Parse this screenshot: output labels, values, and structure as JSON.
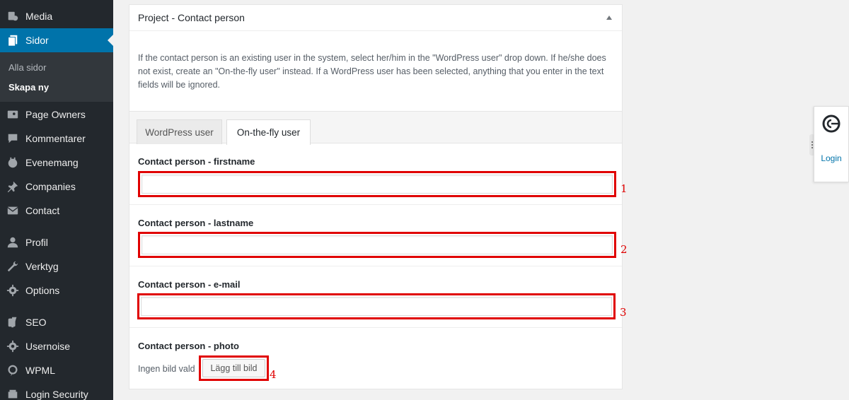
{
  "sidebar": {
    "items": [
      {
        "label": "Media",
        "icon": "media-icon"
      },
      {
        "label": "Sidor",
        "icon": "pages-icon",
        "active": true
      },
      {
        "label": "Page Owners",
        "icon": "page-owners-icon"
      },
      {
        "label": "Kommentarer",
        "icon": "comments-icon"
      },
      {
        "label": "Evenemang",
        "icon": "calendar-icon"
      },
      {
        "label": "Companies",
        "icon": "pin-icon"
      },
      {
        "label": "Contact",
        "icon": "mail-icon"
      },
      {
        "label": "Profil",
        "icon": "user-icon"
      },
      {
        "label": "Verktyg",
        "icon": "wrench-icon"
      },
      {
        "label": "Options",
        "icon": "gear-icon"
      },
      {
        "label": "SEO",
        "icon": "yoast-icon"
      },
      {
        "label": "Usernoise",
        "icon": "gear-icon"
      },
      {
        "label": "WPML",
        "icon": "wpml-icon"
      },
      {
        "label": "Login Security",
        "icon": "security-icon"
      }
    ],
    "submenu": [
      {
        "label": "Alla sidor"
      },
      {
        "label": "Skapa ny",
        "current": true
      }
    ]
  },
  "panel": {
    "title": "Project - Contact person",
    "description": "If the contact person is an existing user in the system, select her/him in the \"WordPress user\" drop down. If he/she does not exist, create an \"On-the-fly user\" instead. If a WordPress user has been selected, anything that you enter in the text fields will be ignored.",
    "tabs": [
      {
        "label": "WordPress user",
        "active": false
      },
      {
        "label": "On-the-fly user",
        "active": true
      }
    ],
    "fields": {
      "firstname": {
        "label": "Contact person - firstname",
        "value": ""
      },
      "lastname": {
        "label": "Contact person - lastname",
        "value": ""
      },
      "email": {
        "label": "Contact person - e-mail",
        "value": ""
      },
      "photo": {
        "label": "Contact person - photo",
        "status": "Ingen bild vald",
        "button": "Lägg till bild"
      }
    }
  },
  "annotations": [
    "1",
    "2",
    "3",
    "4"
  ],
  "widget": {
    "login_label": "Login"
  },
  "colors": {
    "accent": "#0073aa",
    "annotation": "#e00000",
    "sidebar": "#23282d"
  }
}
